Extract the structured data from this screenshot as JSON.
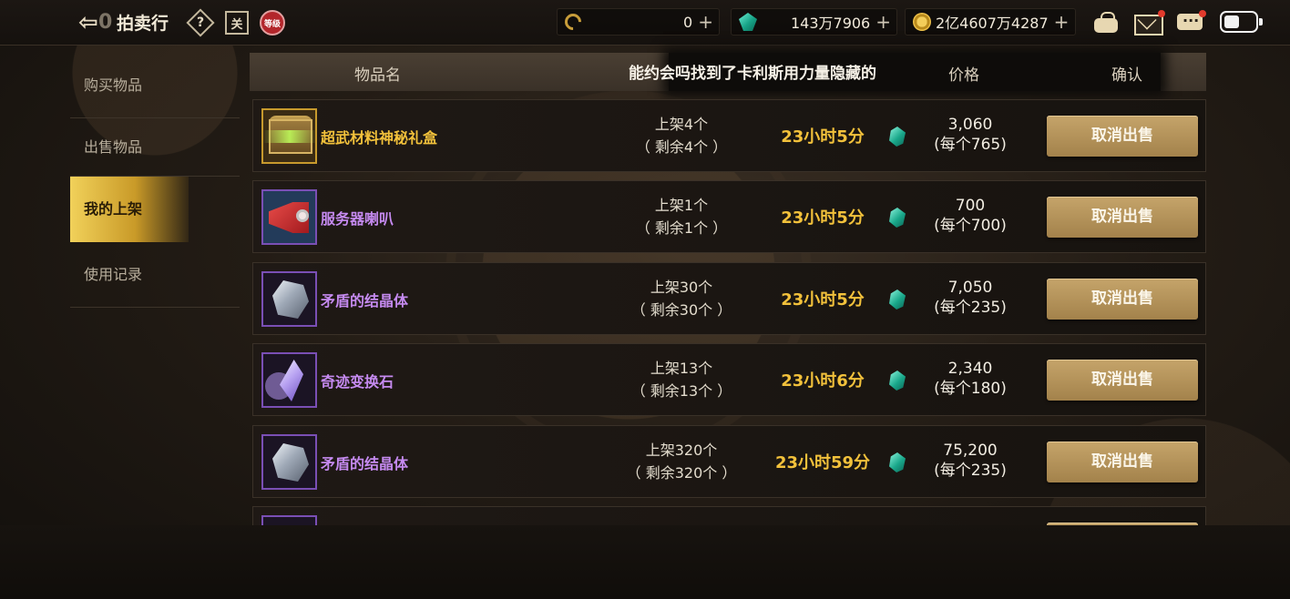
{
  "header": {
    "back_badge": "0",
    "title": "拍卖行",
    "help_icon": "?",
    "calendar_icon": "关",
    "level_icon": "等级"
  },
  "currencies": [
    {
      "icon": "c-icon",
      "value": "0"
    },
    {
      "icon": "gem-icon",
      "value": "143万7906"
    },
    {
      "icon": "gold-coin-icon",
      "value": "2亿4607万4287"
    }
  ],
  "plus": "+",
  "sidebar": {
    "items": [
      {
        "label": "购买物品"
      },
      {
        "label": "出售物品"
      },
      {
        "label": "我的上架"
      },
      {
        "label": "使用记录"
      }
    ],
    "active_index": 2
  },
  "table": {
    "columns": {
      "name": "物品名",
      "price": "价格",
      "confirm": "确认"
    },
    "marquee": "能约会吗找到了卡利斯用力量隐藏的"
  },
  "rows": [
    {
      "name": "超武材料神秘礼盒",
      "name_color": "#f2c13b",
      "icon": "chest-icon",
      "qty": "上架4个",
      "remaining": "（ 剩余4个 ）",
      "time": "23小时5分",
      "total": "3,060",
      "unit": "(每个765)",
      "action": "取消出售"
    },
    {
      "name": "服务器喇叭",
      "name_color": "#c58af0",
      "icon": "megaphone-icon",
      "qty": "上架1个",
      "remaining": "（ 剩余1个 ）",
      "time": "23小时5分",
      "total": "700",
      "unit": "(每个700)",
      "action": "取消出售"
    },
    {
      "name": "矛盾的结晶体",
      "name_color": "#c58af0",
      "icon": "crystal-icon",
      "qty": "上架30个",
      "remaining": "（ 剩余30个 ）",
      "time": "23小时5分",
      "total": "7,050",
      "unit": "(每个235)",
      "action": "取消出售"
    },
    {
      "name": "奇迹变换石",
      "name_color": "#c58af0",
      "icon": "shard-icon",
      "qty": "上架13个",
      "remaining": "（ 剩余13个 ）",
      "time": "23小时6分",
      "total": "2,340",
      "unit": "(每个180)",
      "action": "取消出售"
    },
    {
      "name": "矛盾的结晶体",
      "name_color": "#c58af0",
      "icon": "crystal-icon",
      "qty": "上架320个",
      "remaining": "（ 剩余320个 ）",
      "time": "23小时59分",
      "total": "75,200",
      "unit": "(每个235)",
      "action": "取消出售"
    }
  ]
}
